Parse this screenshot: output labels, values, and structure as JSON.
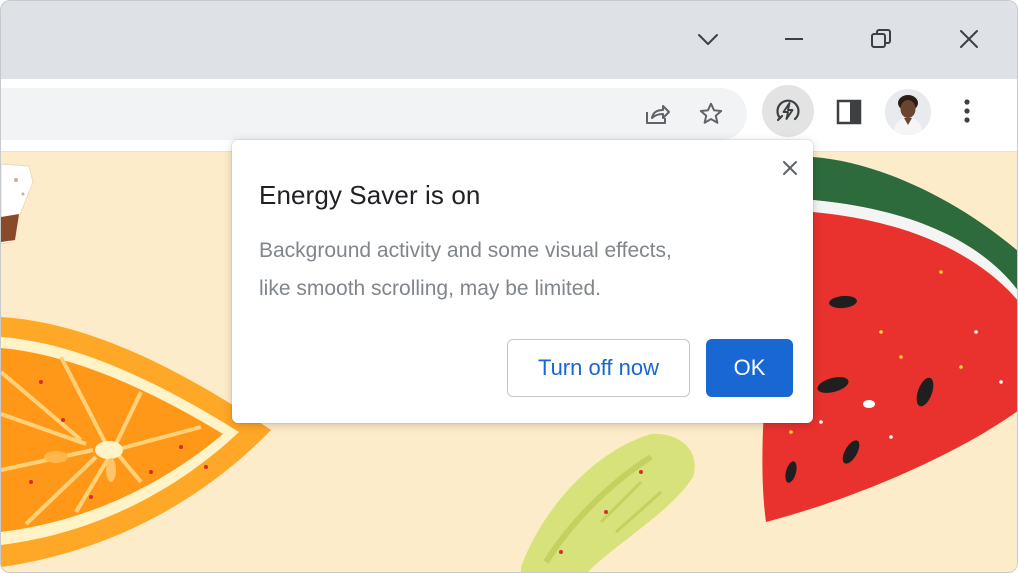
{
  "window_controls": {
    "tab_search_icon": "chevron-down-icon",
    "minimize_icon": "minimize-icon",
    "restore_icon": "restore-icon",
    "close_icon": "close-icon"
  },
  "toolbar": {
    "share_icon": "share-icon",
    "bookmark_icon": "star-icon",
    "energy_saver_icon": "energy-saver-icon",
    "side_panel_icon": "side-panel-icon",
    "menu_icon": "more-vert-icon"
  },
  "dialog": {
    "title": "Energy Saver is on",
    "body_line1": "Background activity and some visual effects,",
    "body_line2": "like smooth scrolling, may be limited.",
    "secondary_button": "Turn off now",
    "primary_button": "OK"
  },
  "colors": {
    "accent": "#1967d2",
    "page_background": "#fdecc9",
    "titlebar": "#dee1e6"
  }
}
